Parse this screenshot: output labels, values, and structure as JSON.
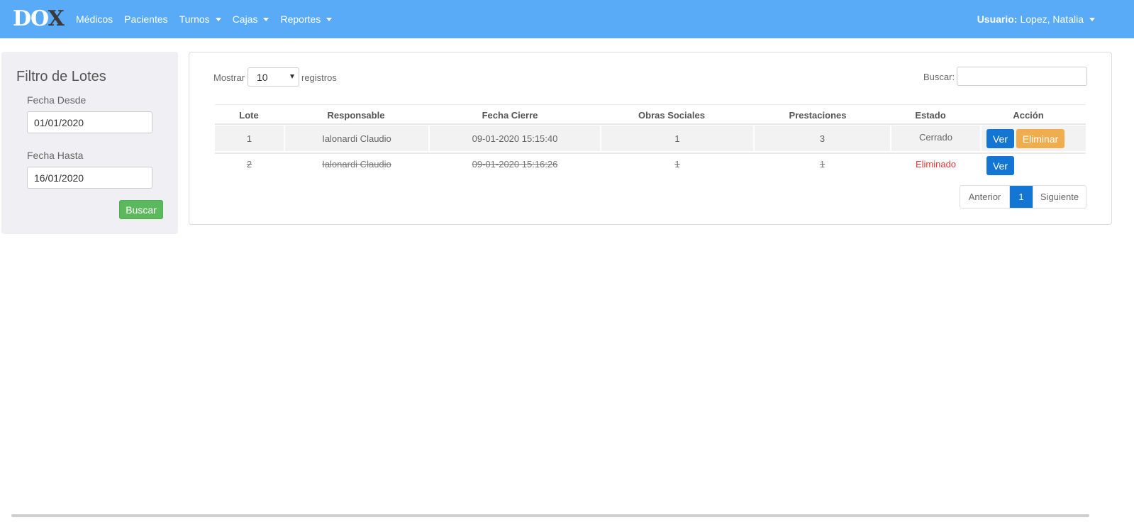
{
  "navbar": {
    "brand_part1": "DO",
    "brand_part2": "X",
    "items": [
      {
        "label": "Médicos"
      },
      {
        "label": "Pacientes"
      },
      {
        "label": "Turnos"
      },
      {
        "label": "Cajas"
      },
      {
        "label": "Reportes"
      }
    ],
    "user_label": "Usuario:",
    "user_name": "Lopez, Natalia"
  },
  "filter": {
    "title": "Filtro de Lotes",
    "desde_label": "Fecha Desde",
    "desde_value": "01/01/2020",
    "hasta_label": "Fecha Hasta",
    "hasta_value": "16/01/2020",
    "buscar_label": "Buscar"
  },
  "table_controls": {
    "show_label": "Mostrar",
    "show_value": "10",
    "records_label": "registros",
    "search_label": "Buscar:",
    "search_value": ""
  },
  "table": {
    "headers": [
      "Lote",
      "Responsable",
      "Fecha Cierre",
      "Obras Sociales",
      "Prestaciones",
      "Estado",
      "Acción"
    ],
    "rows": [
      {
        "lote": "1",
        "responsable": "Ialonardi Claudio",
        "fecha": "09-01-2020 15:15:40",
        "obras": "1",
        "prestaciones": "3",
        "estado": "Cerrado",
        "actions": [
          "Ver",
          "Eliminar"
        ]
      },
      {
        "lote": "2",
        "responsable": "Ialonardi Claudio",
        "fecha": "09-01-2020 15:16:26",
        "obras": "1",
        "prestaciones": "1",
        "estado": "Eliminado",
        "actions": [
          "Ver"
        ]
      }
    ]
  },
  "pagination": {
    "prev": "Anterior",
    "current": "1",
    "next": "Siguiente"
  },
  "colors": {
    "navbar": "#5aabf7",
    "primary": "#1376d3",
    "success": "#5cb85c",
    "warning": "#f0ad4e",
    "danger": "#e53935"
  }
}
